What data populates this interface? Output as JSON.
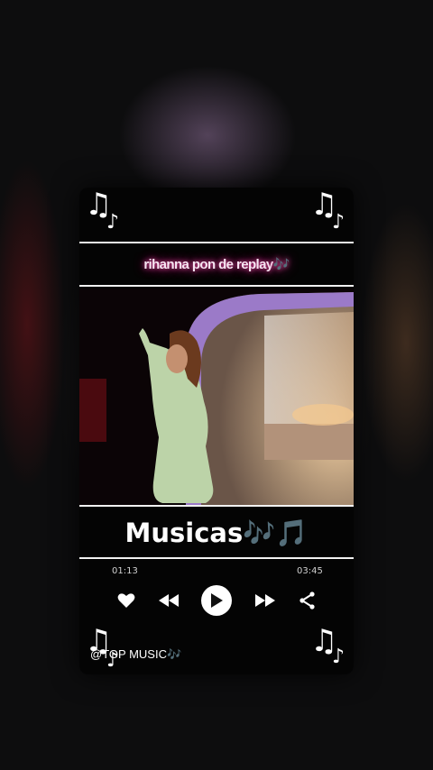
{
  "player": {
    "song_title": "rihanna pon de replay",
    "title_notes": "🎶",
    "brand_text": "Musicas",
    "brand_notes": "🎶🎵",
    "elapsed": "01:13",
    "duration": "03:45",
    "handle": "@TOP MUSIC",
    "handle_notes": "🎶",
    "corner_note": "♫",
    "corner_note_small": "♪"
  },
  "controls": [
    {
      "name": "like-button",
      "icon": "heart-icon"
    },
    {
      "name": "rewind-button",
      "icon": "rewind-icon"
    },
    {
      "name": "play-button",
      "icon": "play-icon"
    },
    {
      "name": "forward-button",
      "icon": "fast-forward-icon"
    },
    {
      "name": "share-button",
      "icon": "share-icon"
    }
  ],
  "colors": {
    "background": "#0d0d0e",
    "card": "#040404",
    "title_glow": "#ff4fb0",
    "brand_notes": "#8fb9a0"
  }
}
